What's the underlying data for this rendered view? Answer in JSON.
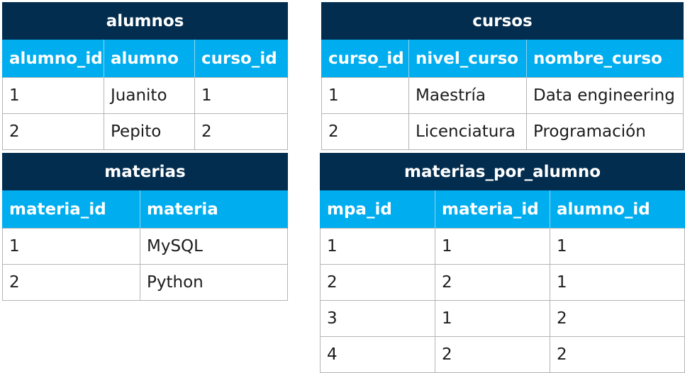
{
  "tables": [
    {
      "title": "alumnos",
      "columns": [
        "alumno_id",
        "alumno",
        "curso_id"
      ],
      "rows": [
        [
          "1",
          "Juanito",
          "1"
        ],
        [
          "2",
          "Pepito",
          "2"
        ]
      ]
    },
    {
      "title": "cursos",
      "columns": [
        "curso_id",
        "nivel_curso",
        "nombre_curso"
      ],
      "rows": [
        [
          "1",
          "Maestría",
          "Data engineering"
        ],
        [
          "2",
          "Licenciatura",
          "Programación"
        ]
      ]
    },
    {
      "title": "materias",
      "columns": [
        "materia_id",
        "materia"
      ],
      "rows": [
        [
          "1",
          "MySQL"
        ],
        [
          "2",
          "Python"
        ]
      ]
    },
    {
      "title": "materias_por_alumno",
      "columns": [
        "mpa_id",
        "materia_id",
        "alumno_id"
      ],
      "rows": [
        [
          "1",
          "1",
          "1"
        ],
        [
          "2",
          "2",
          "1"
        ],
        [
          "3",
          "1",
          "2"
        ],
        [
          "4",
          "2",
          "2"
        ]
      ]
    }
  ],
  "colors": {
    "title_bg": "#032d4f",
    "header_bg": "#00adef",
    "text": "#1c1c1c",
    "border": "#b5b5b5"
  }
}
